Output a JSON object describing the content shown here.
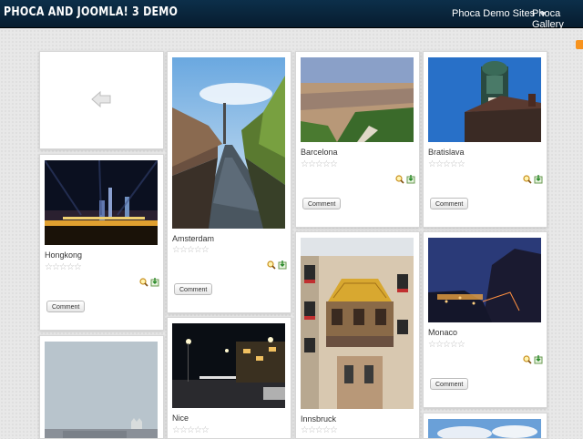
{
  "header": {
    "site_title": "Phoca and Joomla! 3 Demo",
    "nav": {
      "demo_sites": "Phoca Demo Sites",
      "gallery": "Phoca Gallery"
    }
  },
  "gallery": {
    "comment_label": "Comment",
    "rating_stars": "☆☆☆☆☆",
    "items": [
      {
        "title": "Hongkong"
      },
      {
        "title": "Amsterdam"
      },
      {
        "title": "Barcelona"
      },
      {
        "title": "Bratislava"
      },
      {
        "title": "Monaco"
      },
      {
        "title": "Nice"
      },
      {
        "title": "Innsbruck"
      }
    ]
  }
}
